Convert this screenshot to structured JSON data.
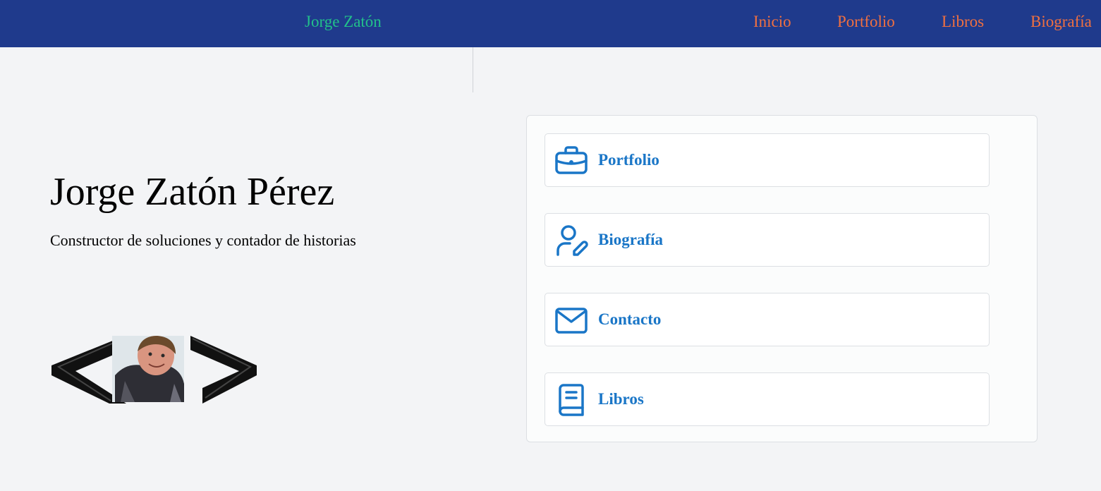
{
  "header": {
    "brand": "Jorge Zatón",
    "nav": [
      {
        "label": "Inicio"
      },
      {
        "label": "Portfolio"
      },
      {
        "label": "Libros"
      },
      {
        "label": "Biografía"
      }
    ]
  },
  "hero": {
    "title": "Jorge Zatón Pérez",
    "subtitle": "Constructor de soluciones y contador de historias",
    "logo_icon": "code-brackets-portrait-logo"
  },
  "links": [
    {
      "label": "Portfolio",
      "icon": "briefcase-icon"
    },
    {
      "label": "Biografía",
      "icon": "user-edit-icon"
    },
    {
      "label": "Contacto",
      "icon": "mail-icon"
    },
    {
      "label": "Libros",
      "icon": "book-icon"
    }
  ],
  "colors": {
    "navbar_bg": "#1f3a8c",
    "brand": "#22c08a",
    "nav_link": "#f07040",
    "link_accent": "#1a76c7",
    "page_bg": "#f3f4f6"
  }
}
